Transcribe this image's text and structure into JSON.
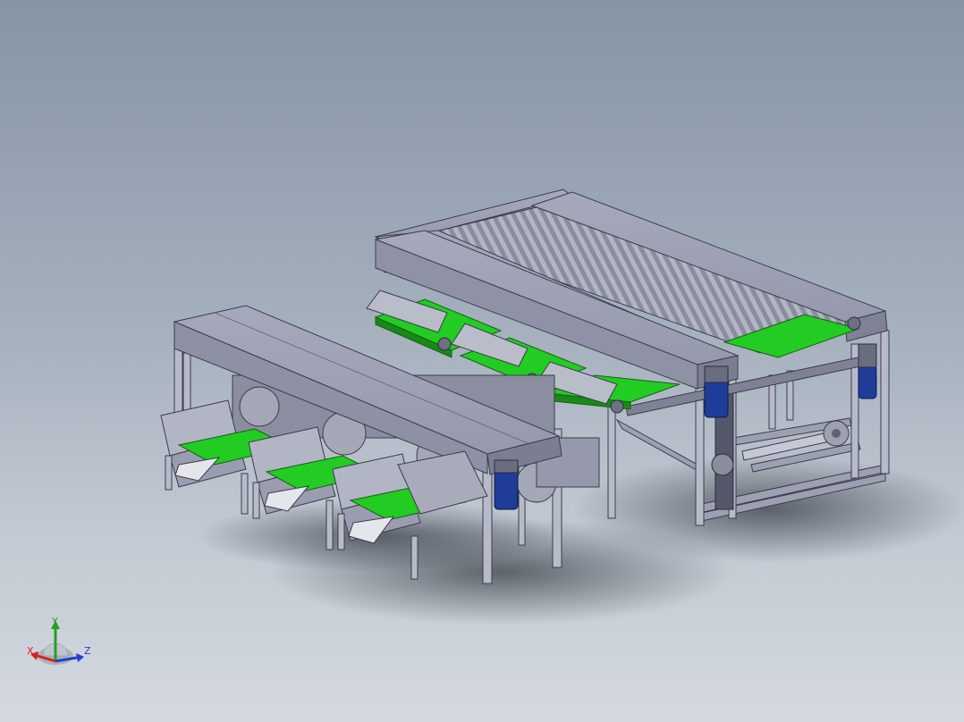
{
  "viewport": {
    "background_top": "#8694a6",
    "background_bottom": "#d4d9df"
  },
  "model": {
    "frame_color": "#8d90a6",
    "belt_color": "#22cc22",
    "motor_color": "#1f3c99",
    "roller_color": "#a9acb8"
  },
  "triad": {
    "x_label": "X",
    "y_label": "Y",
    "z_label": "Z",
    "x_color": "#d82020",
    "y_color": "#22a022",
    "z_color": "#2040d0"
  }
}
